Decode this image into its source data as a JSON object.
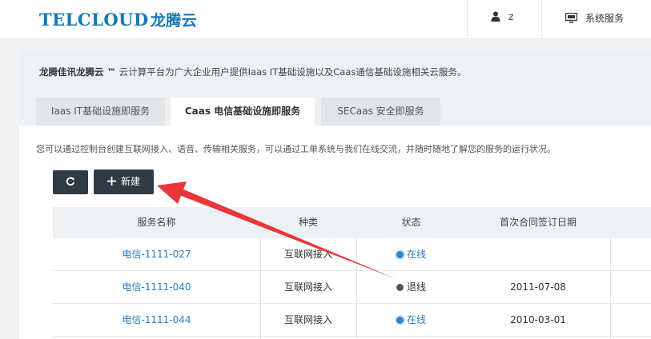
{
  "header": {
    "logo_text": "TELCLOUD",
    "logo_cn": "龙腾云",
    "user_name": "z",
    "system_service": "系统服务"
  },
  "panel": {
    "intro_bold": "龙腾佳讯龙腾云 ™",
    "intro_rest": " 云计算平台为广大企业用户提供Iaas IT基础设施以及Caas通信基础设施相关云服务。",
    "tabs": [
      {
        "label": "Iaas IT基础设施即服务"
      },
      {
        "label": "Caas 电信基础设施即服务"
      },
      {
        "label": "SECaas 安全即服务"
      }
    ],
    "description": "您可以通过控制台创建互联网接入、语音、传输相关服务，可以通过工单系统与我们在线交流，并随时随地了解您的服务的运行状况。"
  },
  "toolbar": {
    "new_label": "新建"
  },
  "table": {
    "headers": [
      "服务名称",
      "种类",
      "状态",
      "首次合同签订日期"
    ],
    "rows": [
      {
        "name": "电信-1111-027",
        "type": "互联网接入",
        "status": "在线",
        "status_key": "online",
        "date": ""
      },
      {
        "name": "电信-1111-040",
        "type": "互联网接入",
        "status": "退线",
        "status_key": "offline",
        "date": "2011-07-08"
      },
      {
        "name": "电信-1111-044",
        "type": "互联网接入",
        "status": "在线",
        "status_key": "online",
        "date": "2010-03-01"
      }
    ]
  },
  "colors": {
    "brand": "#1878b8",
    "link": "#2b7cbf",
    "button": "#303a44",
    "annotation_arrow": "#e8363a"
  }
}
